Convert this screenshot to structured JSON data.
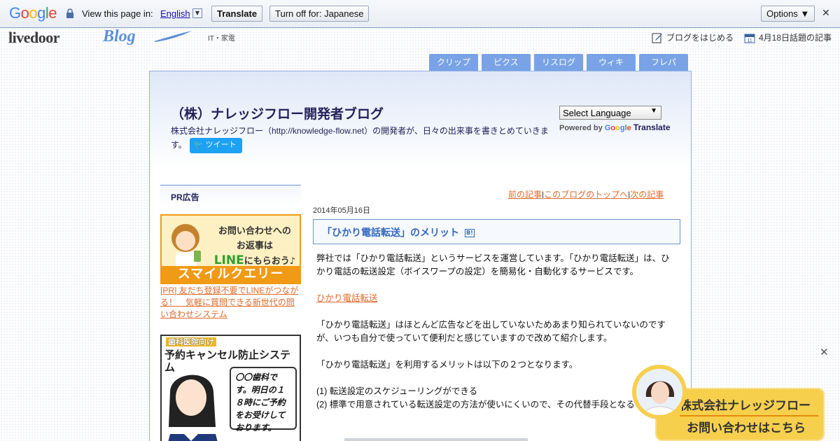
{
  "translate_bar": {
    "google": "Google",
    "view_text": "View this page in:",
    "language": "English",
    "translate_btn": "Translate",
    "turn_off_btn": "Turn off for: Japanese",
    "options_btn": "Options ▼"
  },
  "site_header": {
    "logo": "livedoor",
    "logo_blog": "Blog",
    "category": "IT・家電",
    "start_blog": "ブログをはじめる",
    "topics": "4月18日話題の記事"
  },
  "tabs": [
    "クリップ",
    "ピクス",
    "リスログ",
    "ウィキ",
    "フレパ"
  ],
  "blog": {
    "title": "（株）ナレッジフロー開発者ブログ",
    "description": "株式会社ナレッジフロー（http://knowledge-flow.net）の開発者が、日々の出来事を書きとめていきます。",
    "tweet": "ツイート",
    "select_language": "Select Language",
    "powered_by": "Powered by",
    "google": "Google",
    "translate": "Translate"
  },
  "sidebar": {
    "heading": "PR広告",
    "ad1": {
      "line1": "お問い合わせへの",
      "line2": "お返事は",
      "line3_green": "LINE",
      "line3_rest": "にもらおう♪",
      "banner": "スマイルクエリー",
      "link": "[PR] 友だち登録不要でLINEがつながる！　気軽に質問できる新世代の問い合わせシステム"
    },
    "ad2": {
      "tag": "歯科医院向け",
      "title": "予約キャンセル防止システム",
      "bubble": "〇〇歯科です。明日の１８時にご予約をお受けしております。"
    }
  },
  "entry": {
    "prev": "前の記事",
    "top": "このブログのトップへ",
    "next": "次の記事",
    "date": "2014年05月16日",
    "title": "「ひかり電話転送」のメリット",
    "hatena": "B!",
    "p1": "弊社では「ひかり電話転送」というサービスを運営しています。「ひかり電話転送」は、ひかり電話の転送設定（ボイスワープの設定）を簡易化・自動化するサービスです。",
    "link": "ひかり電話転送",
    "p2": "「ひかり電話転送」はほとんど広告などを出していないためあまり知られていないのですが、いつも自分で使っていて便利だと感じていますので改めて紹介します。",
    "p3": "「ひかり電話転送」を利用するメリットは以下の２つとなります。",
    "li1": "(1) 転送設定のスケジューリングができる",
    "li2": "(2) 標準で用意されている転送設定の方法が使いにくいので、その代替手段となる"
  },
  "contact": {
    "company": "株式会社ナレッジフロー",
    "cta": "お問い合わせはこちら"
  },
  "colors": {
    "tab": "#79a3e6",
    "title": "#23215a",
    "link": "#e06b2c",
    "cta": "#f6cf4d"
  }
}
